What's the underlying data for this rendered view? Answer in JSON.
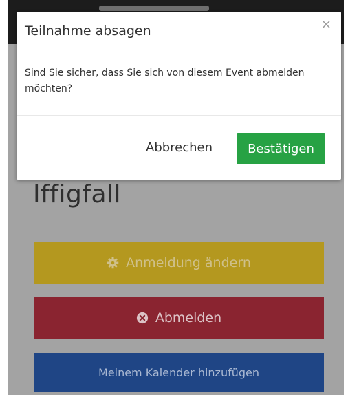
{
  "page": {
    "event_title": "Iffigfall",
    "actions": {
      "change_registration": "Anmeldung ändern",
      "change_icon": "gear-icon",
      "unregister": "Abmelden",
      "unregister_icon": "x-circle-icon",
      "add_to_calendar": "Meinem Kalender hinzufügen"
    }
  },
  "modal": {
    "title": "Teilnahme absagen",
    "close_symbol": "×",
    "message": "Sind Sie sicher, dass Sie sich von diesem Event abmelden möchten?",
    "cancel_label": "Abbrechen",
    "confirm_label": "Bestätigen"
  },
  "colors": {
    "overlay": "#a3a3a3",
    "change_button": "#b4981f",
    "unregister_button": "#8a2430",
    "calendar_button": "#1f4585",
    "confirm_button": "#27a244"
  }
}
